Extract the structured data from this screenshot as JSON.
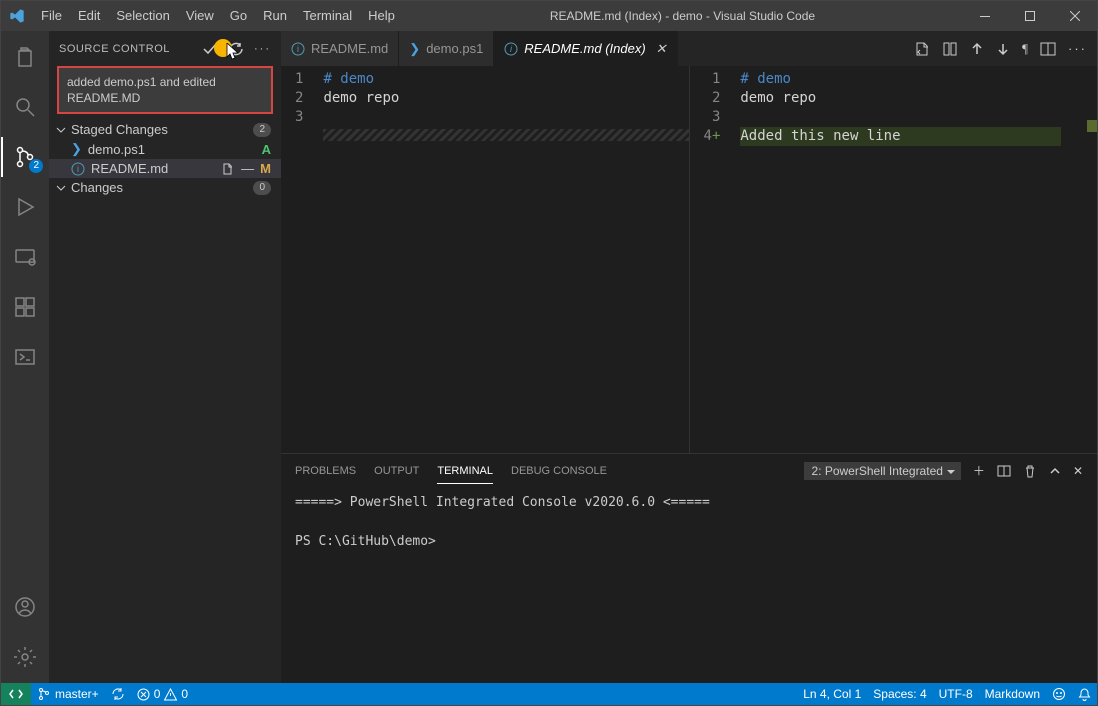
{
  "title": "README.md (Index) - demo - Visual Studio Code",
  "menu": [
    "File",
    "Edit",
    "Selection",
    "View",
    "Go",
    "Run",
    "Terminal",
    "Help"
  ],
  "activity": {
    "scm_badge": "2"
  },
  "sidebar": {
    "header": "SOURCE CONTROL",
    "commit_message": "added demo.ps1 and edited README.MD",
    "staged": {
      "label": "Staged Changes",
      "count": "2",
      "items": [
        {
          "name": "demo.ps1",
          "status": "A",
          "icon": "ps"
        },
        {
          "name": "README.md",
          "status": "M",
          "icon": "md"
        }
      ]
    },
    "changes": {
      "label": "Changes",
      "count": "0"
    }
  },
  "tabs": [
    {
      "label": "README.md",
      "icon": "info",
      "active": false
    },
    {
      "label": "demo.ps1",
      "icon": "ps",
      "active": false
    },
    {
      "label": "README.md (Index)",
      "icon": "info",
      "active": true
    }
  ],
  "left_editor": {
    "lines": [
      {
        "n": "1",
        "text": "# demo",
        "cls": "kw"
      },
      {
        "n": "2",
        "text": "demo repo",
        "cls": "plain"
      },
      {
        "n": "3",
        "text": "",
        "cls": "plain"
      }
    ]
  },
  "right_editor": {
    "lines": [
      {
        "n": "1",
        "prefix": " ",
        "text": "# demo",
        "cls": "kw"
      },
      {
        "n": "2",
        "prefix": " ",
        "text": "demo repo",
        "cls": "plain"
      },
      {
        "n": "3",
        "prefix": " ",
        "text": "",
        "cls": "plain"
      },
      {
        "n": "4",
        "prefix": "+",
        "text": "Added this new line",
        "cls": "diff"
      }
    ]
  },
  "panel": {
    "tabs": [
      "PROBLEMS",
      "OUTPUT",
      "TERMINAL",
      "DEBUG CONSOLE"
    ],
    "active": 2,
    "selector": "2: PowerShell Integrated",
    "lines": [
      "=====> PowerShell Integrated Console v2020.6.0 <=====",
      "",
      "PS C:\\GitHub\\demo>"
    ]
  },
  "status": {
    "branch": "master+",
    "errors": "0",
    "warnings": "0",
    "line": "Ln 4, Col 1",
    "spaces": "Spaces: 4",
    "encoding": "UTF-8",
    "language": "Markdown"
  }
}
